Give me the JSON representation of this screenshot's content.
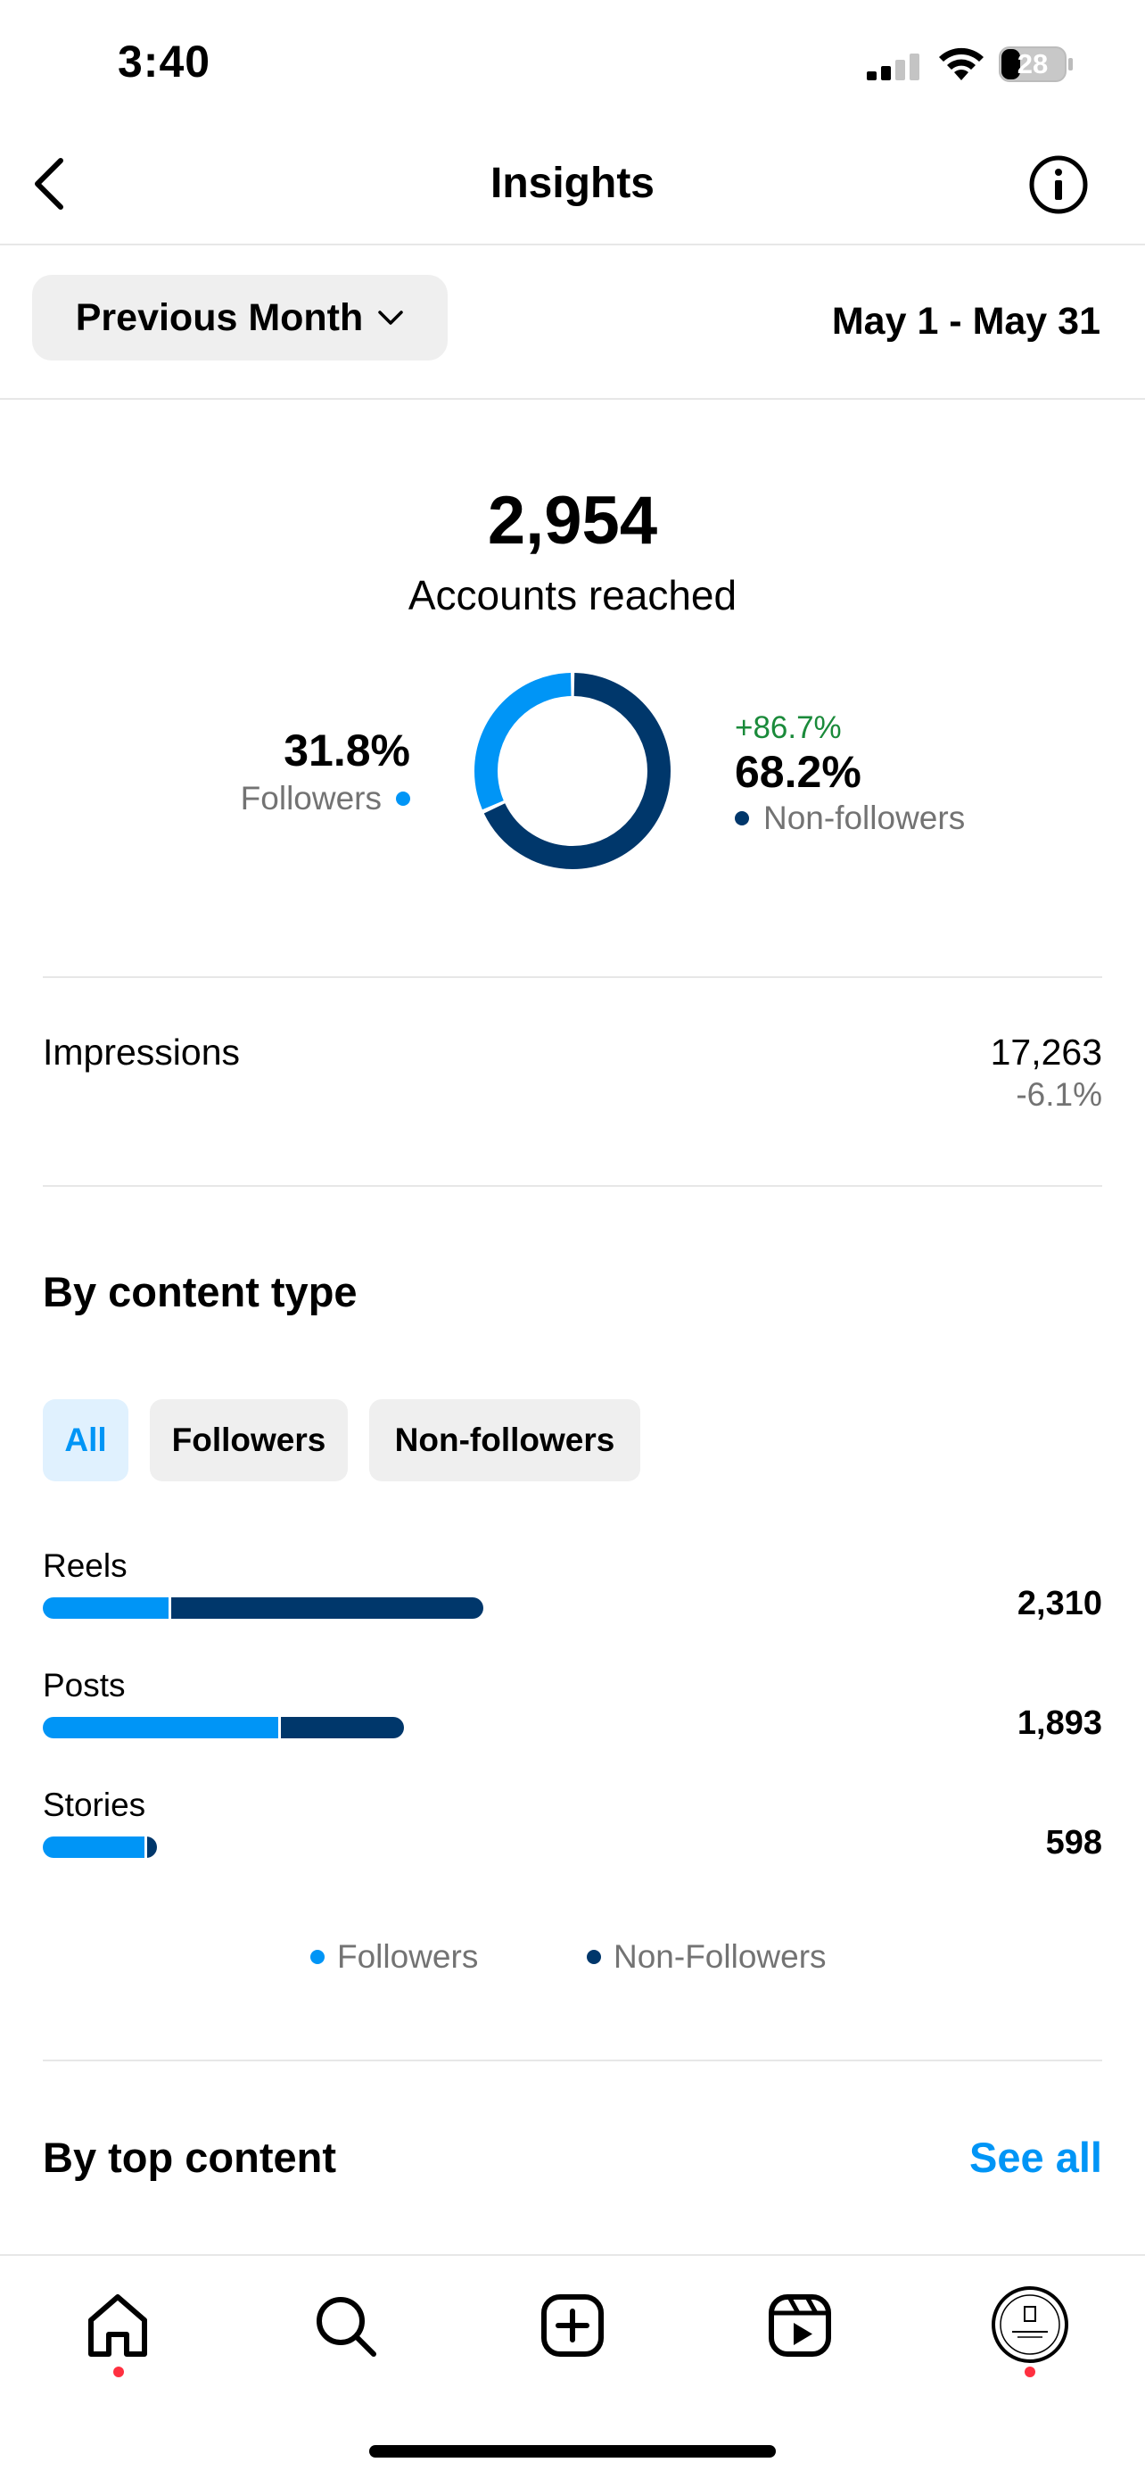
{
  "status_bar": {
    "time": "3:40",
    "battery": "28"
  },
  "header": {
    "title": "Insights"
  },
  "period": {
    "selected": "Previous Month",
    "date_range": "May 1 - May 31"
  },
  "reach": {
    "value": "2,954",
    "label": "Accounts reached",
    "followers": {
      "percent": "31.8%",
      "label": "Followers",
      "fraction": 0.318
    },
    "non_followers": {
      "change": "+86.7%",
      "percent": "68.2%",
      "label": "Non-followers",
      "fraction": 0.682
    }
  },
  "impressions": {
    "label": "Impressions",
    "value": "17,263",
    "change": "-6.1%"
  },
  "by_content_type": {
    "title": "By content type",
    "filters": [
      "All",
      "Followers",
      "Non-followers"
    ],
    "active_filter": "All",
    "max_value": 2310,
    "rows": [
      {
        "label": "Reels",
        "value": "2,310",
        "total": 2310,
        "followers": 660
      },
      {
        "label": "Posts",
        "value": "1,893",
        "total": 1893,
        "followers": 1234
      },
      {
        "label": "Stories",
        "value": "598",
        "total": 598,
        "followers": 532
      }
    ],
    "legend": {
      "followers": "Followers",
      "non_followers": "Non-Followers"
    }
  },
  "top_content": {
    "title": "By top content",
    "see_all": "See all"
  },
  "colors": {
    "followers": "#0095f6",
    "non_followers": "#00376b",
    "accent": "#0095f6",
    "positive": "#1a8a3a",
    "notification": "#ff3040"
  },
  "tab_bar": {
    "items": [
      "home-icon",
      "search-icon",
      "create-icon",
      "reels-icon",
      "profile-avatar"
    ]
  }
}
